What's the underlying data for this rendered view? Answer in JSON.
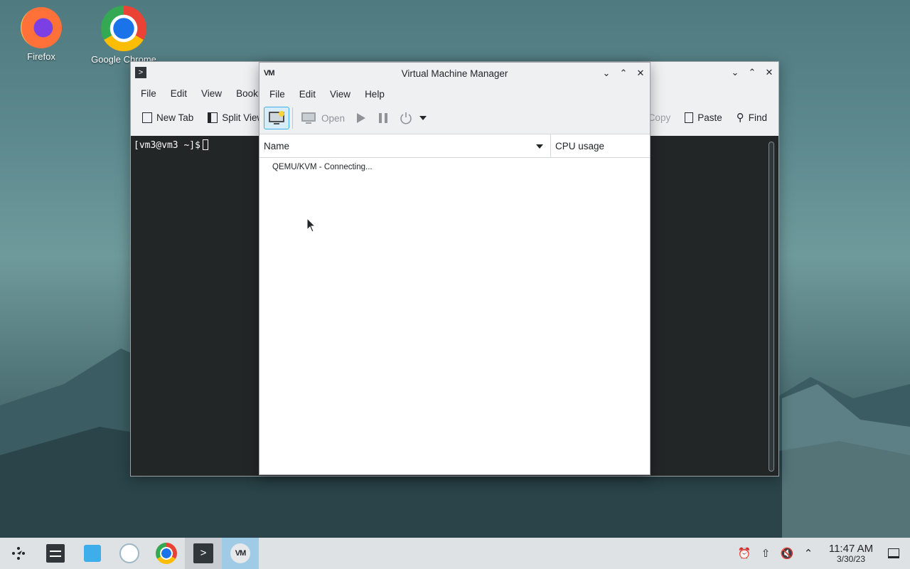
{
  "desktop": {
    "icons": [
      {
        "label": "Firefox"
      },
      {
        "label": "Google Chrome"
      }
    ]
  },
  "konsole": {
    "menu": [
      "File",
      "Edit",
      "View",
      "Bookmarks"
    ],
    "toolbar": {
      "new_tab": "New Tab",
      "split_view": "Split View",
      "copy": "Copy",
      "paste": "Paste",
      "find": "Find"
    },
    "prompt": "[vm3@vm3 ~]$"
  },
  "vmm": {
    "title": "Virtual Machine Manager",
    "menu": [
      "File",
      "Edit",
      "View",
      "Help"
    ],
    "toolbar": {
      "open": "Open"
    },
    "columns": {
      "name": "Name",
      "cpu": "CPU usage"
    },
    "connection_status": "QEMU/KVM - Connecting..."
  },
  "taskbar": {
    "time": "11:47 AM",
    "date": "3/30/23"
  },
  "colors": {
    "accent": "#3daee9",
    "terminal_bg": "#232627",
    "taskbar_bg": "#dfe2e5"
  }
}
